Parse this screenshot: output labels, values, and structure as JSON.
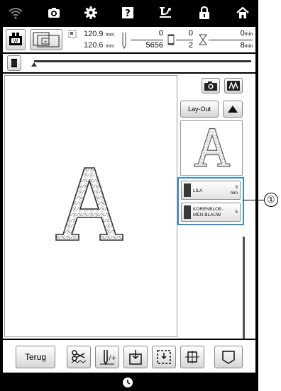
{
  "topbar": {
    "icons": [
      "wifi-icon",
      "camera-icon",
      "settings-icon",
      "help-icon",
      "tension-icon",
      "lock-icon",
      "home-icon"
    ]
  },
  "infobar": {
    "width_value": "120.9",
    "height_value": "120.6",
    "unit_mm": "mm",
    "stitch_current": "0",
    "stitch_total": "5656",
    "color_current": "0",
    "color_total": "2",
    "time_current": "0",
    "time_total": "8",
    "unit_min": "min"
  },
  "side": {
    "layout_label": "Lay-Out"
  },
  "colors": [
    {
      "name_line1": "LILA",
      "name_line2": "",
      "time": "3",
      "time_unit": "min",
      "swatch": "#3a3a3a"
    },
    {
      "name_line1": "KORENBLOE-",
      "name_line2": "MEN BLAUW",
      "time": "5",
      "time_unit": "",
      "swatch": "#3a3a3a"
    }
  ],
  "bottombar": {
    "back_label": "Terug"
  },
  "callout": {
    "number": "①"
  },
  "theme": {
    "highlight": "#2d8fd5",
    "bar_bg": "#000000"
  }
}
